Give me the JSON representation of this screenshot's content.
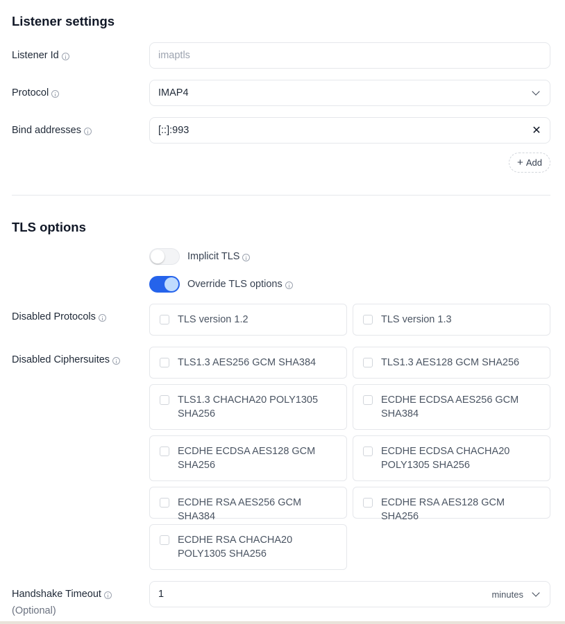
{
  "listener_section": {
    "title": "Listener settings",
    "listener_id": {
      "label": "Listener Id",
      "value": "imaptls"
    },
    "protocol": {
      "label": "Protocol",
      "value": "IMAP4"
    },
    "bind_addresses": {
      "label": "Bind addresses",
      "value": "[::]:993"
    },
    "add_label": "Add"
  },
  "tls_section": {
    "title": "TLS options",
    "implicit_tls": {
      "label": "Implicit TLS",
      "enabled": false
    },
    "override_tls": {
      "label": "Override TLS options",
      "enabled": true
    },
    "disabled_protocols": {
      "label": "Disabled Protocols",
      "options": [
        "TLS version 1.2",
        "TLS version 1.3"
      ]
    },
    "disabled_ciphersuites": {
      "label": "Disabled Ciphersuites",
      "options": [
        "TLS1.3 AES256 GCM SHA384",
        "TLS1.3 AES128 GCM SHA256",
        "TLS1.3 CHACHA20 POLY1305 SHA256",
        "ECDHE ECDSA AES256 GCM SHA384",
        "ECDHE ECDSA AES128 GCM SHA256",
        "ECDHE ECDSA CHACHA20 POLY1305 SHA256",
        "ECDHE RSA AES256 GCM SHA384",
        "ECDHE RSA AES128 GCM SHA256",
        "ECDHE RSA CHACHA20 POLY1305 SHA256"
      ]
    },
    "handshake_timeout": {
      "label": "Handshake Timeout",
      "optional": "(Optional)",
      "value": "1",
      "unit": "minutes"
    }
  },
  "icons": {
    "info": "info-circle-icon",
    "chevron": "chevron-down-icon",
    "clear": "close-icon",
    "add": "plus-icon"
  },
  "colors": {
    "accent": "#2563eb",
    "border": "#e5e7eb"
  }
}
